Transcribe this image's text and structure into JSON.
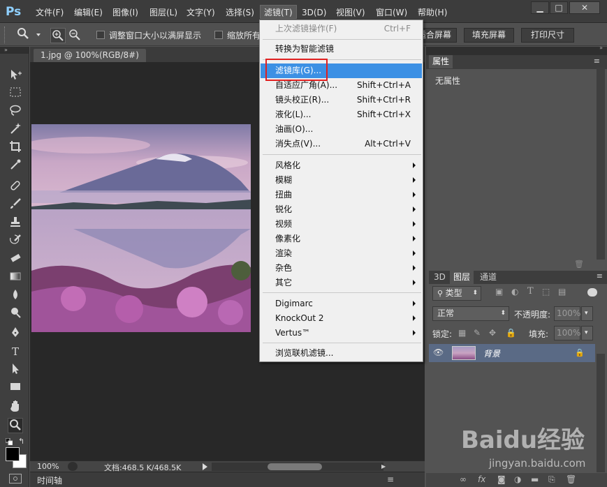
{
  "app": {
    "logo": "Ps"
  },
  "menubar": {
    "items": [
      "文件(F)",
      "编辑(E)",
      "图像(I)",
      "图层(L)",
      "文字(Y)",
      "选择(S)",
      "滤镜(T)",
      "3D(D)",
      "视图(V)",
      "窗口(W)",
      "帮助(H)"
    ],
    "active": "滤镜(T)"
  },
  "options": {
    "fit_window_label": "调整窗口大小以满屏显示",
    "zoom_all_label": "缩放所有",
    "fit_screen": "适合屏幕",
    "fill_screen": "填充屏幕",
    "print_size": "打印尺寸"
  },
  "document": {
    "tab": "1.jpg @ 100%(RGB/8#)",
    "zoom": "100%",
    "doc_info": "文档:468.5 K/468.5K",
    "timeline_label": "时间轴"
  },
  "filter_menu": {
    "items": [
      {
        "label": "上次滤镜操作(F)",
        "shortcut": "Ctrl+F",
        "disabled": true
      },
      {
        "label": "转换为智能滤镜",
        "shortcut": ""
      },
      {
        "label": "滤镜库(G)...",
        "shortcut": "",
        "highlighted": true
      },
      {
        "label": "自适应广角(A)...",
        "shortcut": "Shift+Ctrl+A"
      },
      {
        "label": "镜头校正(R)...",
        "shortcut": "Shift+Ctrl+R"
      },
      {
        "label": "液化(L)...",
        "shortcut": "Shift+Ctrl+X"
      },
      {
        "label": "油画(O)...",
        "shortcut": ""
      },
      {
        "label": "消失点(V)...",
        "shortcut": "Alt+Ctrl+V"
      },
      {
        "label": "风格化",
        "submenu": true
      },
      {
        "label": "模糊",
        "submenu": true
      },
      {
        "label": "扭曲",
        "submenu": true
      },
      {
        "label": "锐化",
        "submenu": true
      },
      {
        "label": "视频",
        "submenu": true
      },
      {
        "label": "像素化",
        "submenu": true
      },
      {
        "label": "渲染",
        "submenu": true
      },
      {
        "label": "杂色",
        "submenu": true
      },
      {
        "label": "其它",
        "submenu": true
      },
      {
        "label": "Digimarc",
        "submenu": true
      },
      {
        "label": "KnockOut 2",
        "submenu": true
      },
      {
        "label": "Vertus™",
        "submenu": true
      },
      {
        "label": "浏览联机滤镜...",
        "shortcut": ""
      }
    ]
  },
  "properties_panel": {
    "tab": "属性",
    "content": "无属性"
  },
  "layers_panel": {
    "tabs": [
      "3D",
      "图层",
      "通道"
    ],
    "active_tab": "图层",
    "filter_kind": "类型",
    "blend_mode": "正常",
    "opacity_label": "不透明度:",
    "opacity_value": "100%",
    "lock_label": "锁定:",
    "fill_label": "填充:",
    "fill_value": "100%",
    "layers": [
      {
        "name": "背景",
        "visible": true,
        "locked": true
      }
    ]
  },
  "watermark": {
    "logo": "Baidu经验",
    "url": "jingyan.baidu.com"
  },
  "colors": {
    "menu_highlight": "#3c90e4",
    "callout_border": "#e02020",
    "active_layer": "#5a6a85"
  }
}
